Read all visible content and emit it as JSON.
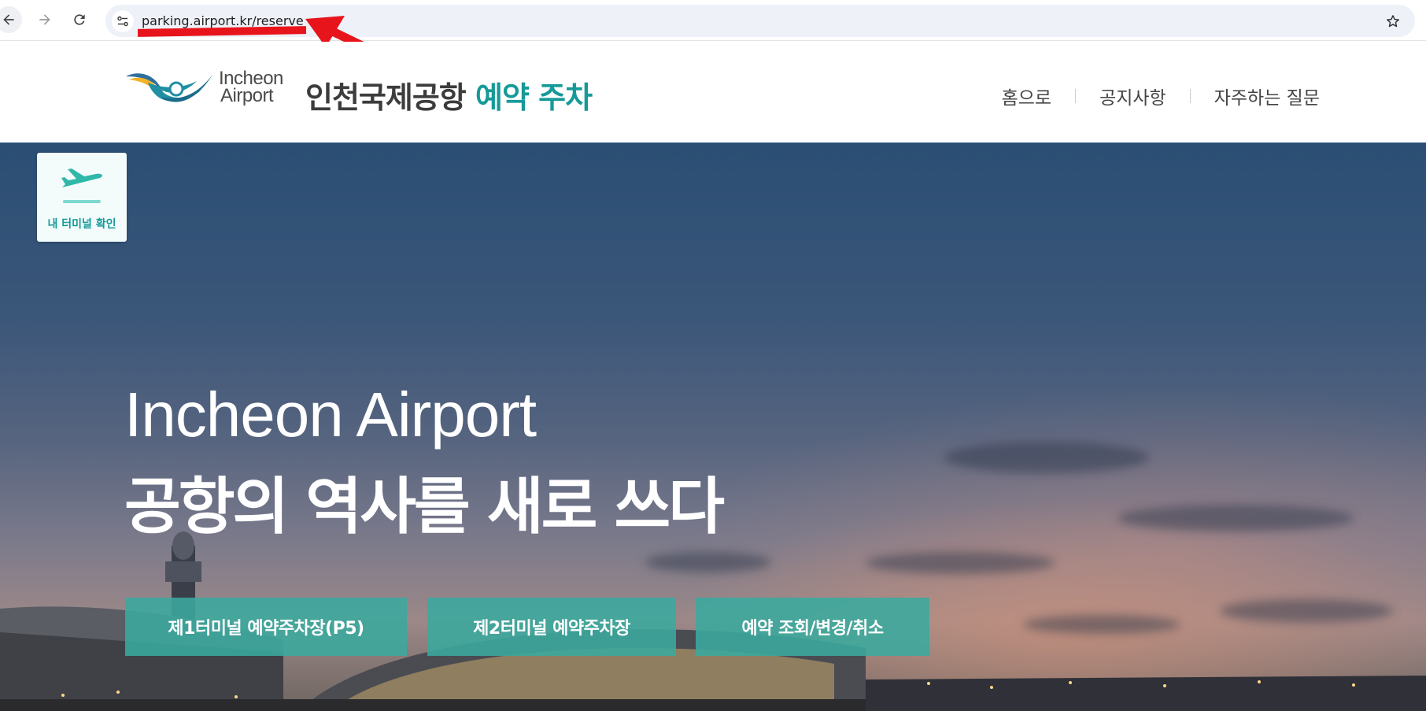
{
  "browser": {
    "url": "parking.airport.kr/reserve"
  },
  "header": {
    "logo_line1": "Incheon",
    "logo_line2": "Airport",
    "title_main": "인천국제공항",
    "title_accent": "예약 주차",
    "nav": [
      "홈으로",
      "공지사항",
      "자주하는 질문"
    ]
  },
  "hero": {
    "terminal_check_label": "내 터미널 확인",
    "eyebrow": "Incheon Airport",
    "headline": "공항의 역사를 새로 쓰다",
    "cta": [
      "제1터미널 예약주차장(P5)",
      "제2터미널 예약주차장",
      "예약 조회/변경/취소"
    ]
  },
  "colors": {
    "accent": "#159a99",
    "cta_bg": "#3aaa9e",
    "annotation_red": "#e8141b"
  }
}
